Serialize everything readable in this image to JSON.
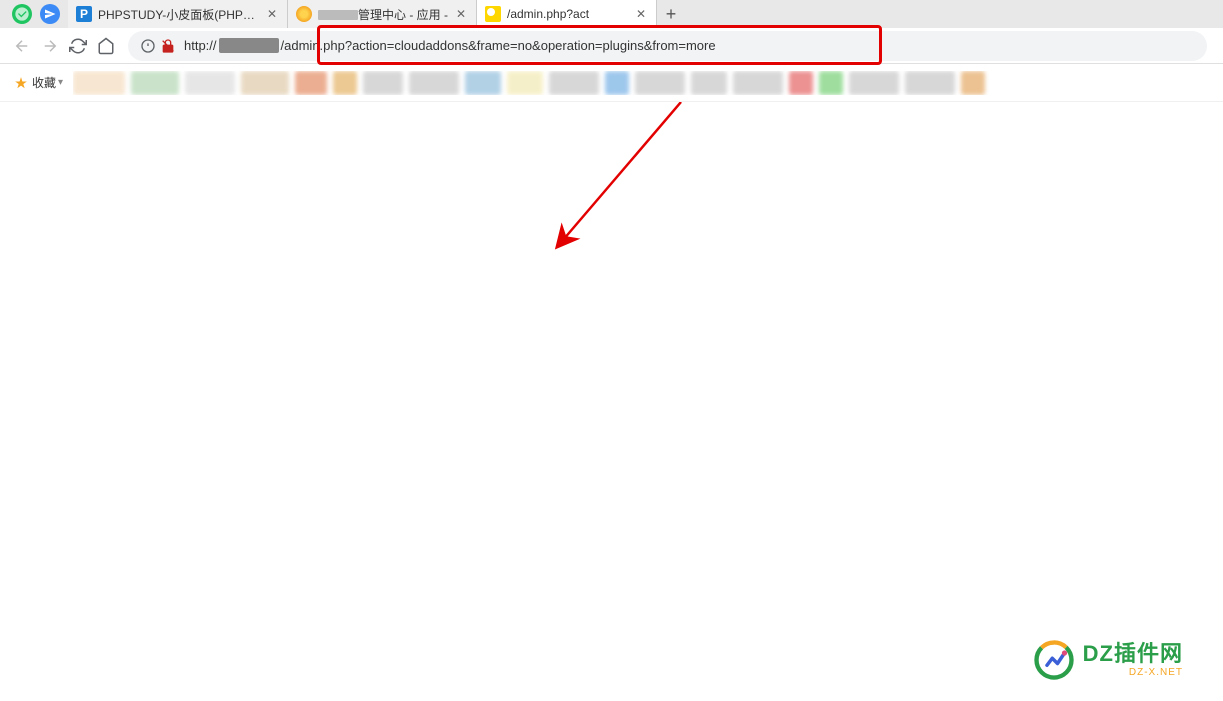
{
  "tabs": [
    {
      "title": "PHPSTUDY-小皮面板(PHPStu",
      "favicon": "P"
    },
    {
      "title_suffix": "管理中心 - 应用 -",
      "favicon": "orange"
    },
    {
      "title": "/admin.php?act",
      "favicon": "yellow",
      "active": true
    }
  ],
  "url": {
    "protocol": "http://",
    "path": "/admin.php?action=cloudaddons&frame=no&operation=plugins&from=more"
  },
  "bookmarks": {
    "label": "收藏"
  },
  "bookmark_blurs": [
    {
      "w": 52,
      "c": "#f2d6b3"
    },
    {
      "w": 48,
      "c": "#a6d0a6"
    },
    {
      "w": 50,
      "c": "#d7d7d7"
    },
    {
      "w": 48,
      "c": "#d9c19a"
    },
    {
      "w": 32,
      "c": "#e07a4a"
    },
    {
      "w": 24,
      "c": "#e0a54a"
    },
    {
      "w": 40,
      "c": "#bdbdbd"
    },
    {
      "w": 50,
      "c": "#bdbdbd"
    },
    {
      "w": 36,
      "c": "#7fb3d5"
    },
    {
      "w": 36,
      "c": "#f0e6a6"
    },
    {
      "w": 50,
      "c": "#bdbdbd"
    },
    {
      "w": 24,
      "c": "#5fa3e0"
    },
    {
      "w": 50,
      "c": "#bdbdbd"
    },
    {
      "w": 36,
      "c": "#bdbdbd"
    },
    {
      "w": 50,
      "c": "#bdbdbd"
    },
    {
      "w": 24,
      "c": "#e04a4a"
    },
    {
      "w": 24,
      "c": "#5fc75f"
    },
    {
      "w": 50,
      "c": "#bdbdbd"
    },
    {
      "w": 50,
      "c": "#bdbdbd"
    },
    {
      "w": 24,
      "c": "#e09a4a"
    }
  ],
  "watermark": {
    "title": "DZ插件网",
    "sub": "DZ-X.NET"
  }
}
